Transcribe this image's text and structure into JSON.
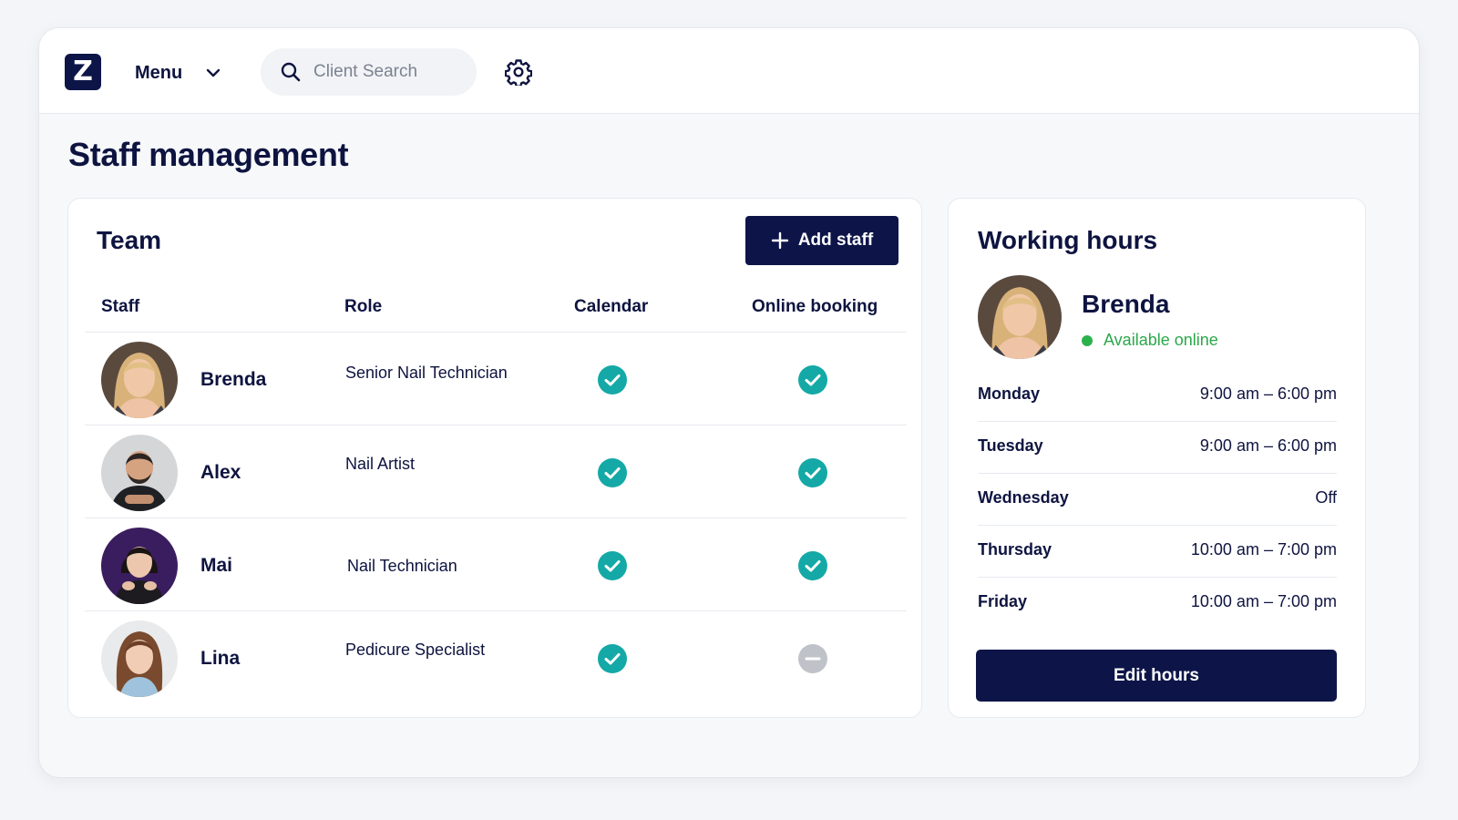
{
  "topbar": {
    "logo_letter": "Z",
    "menu_label": "Menu",
    "search_placeholder": "Client Search"
  },
  "page_title": "Staff management",
  "team": {
    "title": "Team",
    "add_button": "Add staff",
    "columns": [
      "Staff",
      "Role",
      "Calendar",
      "Online booking"
    ],
    "rows": [
      {
        "name": "Brenda",
        "role": "Senior Nail Technician",
        "calendar": true,
        "online_booking": true
      },
      {
        "name": "Alex",
        "role": "Nail Artist",
        "calendar": true,
        "online_booking": true
      },
      {
        "name": "Mai",
        "role": "Nail Technician",
        "calendar": true,
        "online_booking": true
      },
      {
        "name": "Lina",
        "role": "Pedicure Specialist",
        "calendar": true,
        "online_booking": false
      }
    ]
  },
  "working_hours": {
    "title": "Working hours",
    "name": "Brenda",
    "status": "Available online",
    "schedule": [
      {
        "day": "Monday",
        "hours": "9:00 am – 6:00 pm"
      },
      {
        "day": "Tuesday",
        "hours": "9:00 am – 6:00 pm"
      },
      {
        "day": "Wednesday",
        "hours": "Off"
      },
      {
        "day": "Thursday",
        "hours": "10:00 am – 7:00 pm"
      },
      {
        "day": "Friday",
        "hours": "10:00 am – 7:00 pm"
      }
    ],
    "edit_button": "Edit hours"
  },
  "colors": {
    "brand_navy": "#0d1548",
    "check_teal": "#14a9a6",
    "off_gray": "#bfc3c9",
    "online_green": "#2bb24c"
  },
  "icons": {
    "logo": "z-logo-icon",
    "menu_caret": "chevron-down-icon",
    "search": "search-icon",
    "settings": "gear-icon",
    "enabled": "check-circle-icon",
    "disabled": "minus-circle-icon",
    "add": "plus-icon"
  }
}
